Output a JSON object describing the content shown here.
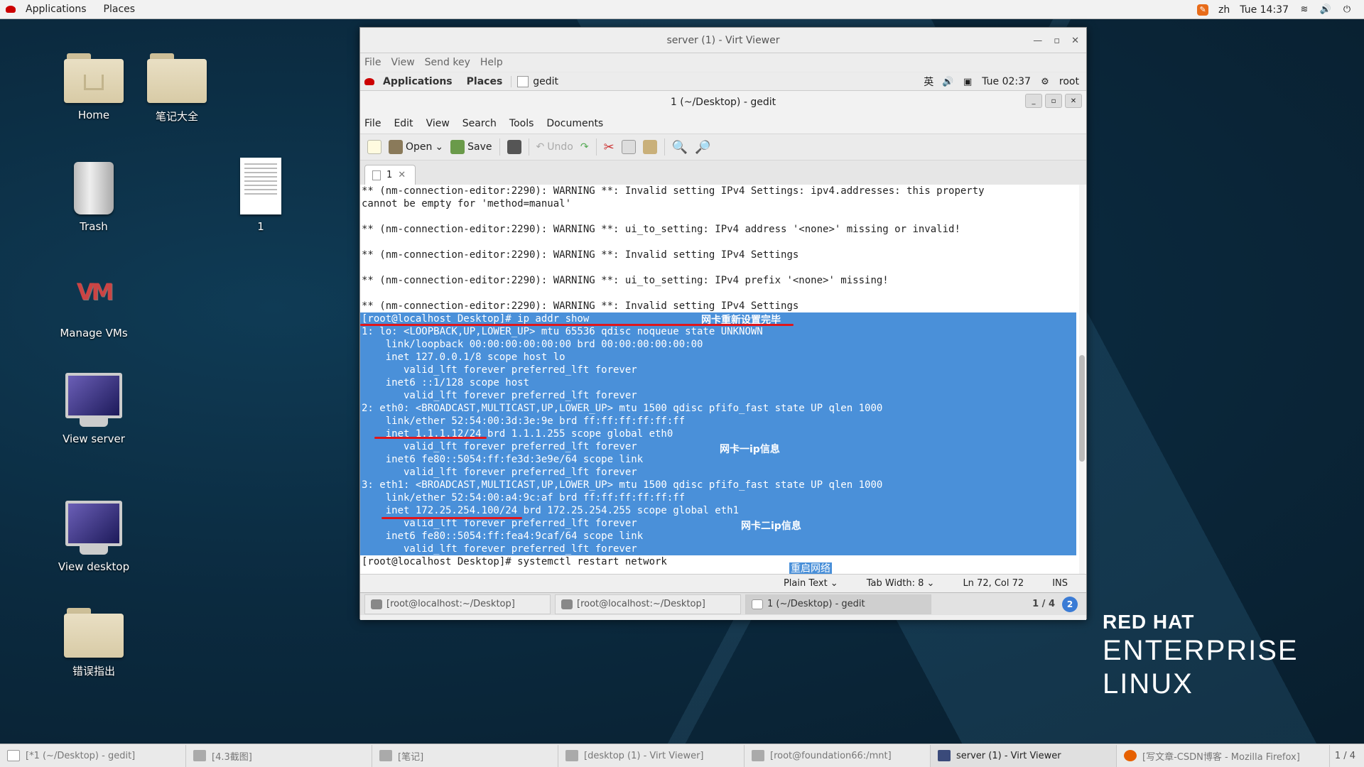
{
  "topbar": {
    "applications": "Applications",
    "places": "Places",
    "lang": "zh",
    "time": "Tue 14:37"
  },
  "desktop": {
    "icons": [
      {
        "label": "Home"
      },
      {
        "label": "笔记大全"
      },
      {
        "label": "Trash"
      },
      {
        "label": "1"
      },
      {
        "label": "Manage VMs"
      },
      {
        "label": "View server"
      },
      {
        "label": "View desktop"
      },
      {
        "label": "错误指出"
      }
    ]
  },
  "viewer": {
    "title": "server (1) - Virt Viewer",
    "menu": [
      "File",
      "View",
      "Send key",
      "Help"
    ]
  },
  "guest": {
    "topbar": {
      "applications": "Applications",
      "places": "Places",
      "app": "gedit",
      "lang": "英",
      "time": "Tue 02:37",
      "user": "root"
    },
    "window_title": "1 (~/Desktop) - gedit",
    "menu": [
      "File",
      "Edit",
      "View",
      "Search",
      "Tools",
      "Documents"
    ],
    "toolbar": {
      "open": "Open",
      "save": "Save",
      "undo": "Undo"
    },
    "tab": {
      "label": "1"
    },
    "lines": [
      {
        "t": "** (nm-connection-editor:2290): WARNING **: Invalid setting IPv4 Settings: ipv4.addresses: this property",
        "s": false
      },
      {
        "t": "cannot be empty for 'method=manual'",
        "s": false
      },
      {
        "t": "",
        "s": false
      },
      {
        "t": "** (nm-connection-editor:2290): WARNING **: ui_to_setting: IPv4 address '<none>' missing or invalid!",
        "s": false
      },
      {
        "t": "",
        "s": false
      },
      {
        "t": "** (nm-connection-editor:2290): WARNING **: Invalid setting IPv4 Settings",
        "s": false
      },
      {
        "t": "",
        "s": false
      },
      {
        "t": "** (nm-connection-editor:2290): WARNING **: ui_to_setting: IPv4 prefix '<none>' missing!",
        "s": false
      },
      {
        "t": "",
        "s": false
      },
      {
        "t": "** (nm-connection-editor:2290): WARNING **: Invalid setting IPv4 Settings",
        "s": false
      },
      {
        "t": "[root@localhost Desktop]# ip addr show",
        "s": true
      },
      {
        "t": "1: lo: <LOOPBACK,UP,LOWER_UP> mtu 65536 qdisc noqueue state UNKNOWN",
        "s": true
      },
      {
        "t": "    link/loopback 00:00:00:00:00:00 brd 00:00:00:00:00:00",
        "s": true
      },
      {
        "t": "    inet 127.0.0.1/8 scope host lo",
        "s": true
      },
      {
        "t": "       valid_lft forever preferred_lft forever",
        "s": true
      },
      {
        "t": "    inet6 ::1/128 scope host",
        "s": true
      },
      {
        "t": "       valid_lft forever preferred_lft forever",
        "s": true
      },
      {
        "t": "2: eth0: <BROADCAST,MULTICAST,UP,LOWER_UP> mtu 1500 qdisc pfifo_fast state UP qlen 1000",
        "s": true
      },
      {
        "t": "    link/ether 52:54:00:3d:3e:9e brd ff:ff:ff:ff:ff:ff",
        "s": true
      },
      {
        "t": "    inet 1.1.1.12/24 brd 1.1.1.255 scope global eth0",
        "s": true
      },
      {
        "t": "       valid_lft forever preferred_lft forever",
        "s": true
      },
      {
        "t": "    inet6 fe80::5054:ff:fe3d:3e9e/64 scope link",
        "s": true
      },
      {
        "t": "       valid_lft forever preferred_lft forever",
        "s": true
      },
      {
        "t": "3: eth1: <BROADCAST,MULTICAST,UP,LOWER_UP> mtu 1500 qdisc pfifo_fast state UP qlen 1000",
        "s": true
      },
      {
        "t": "    link/ether 52:54:00:a4:9c:af brd ff:ff:ff:ff:ff:ff",
        "s": true
      },
      {
        "t": "    inet 172.25.254.100/24 brd 172.25.254.255 scope global eth1",
        "s": true
      },
      {
        "t": "       valid_lft forever preferred_lft forever",
        "s": true
      },
      {
        "t": "    inet6 fe80::5054:ff:fea4:9caf/64 scope link",
        "s": true
      },
      {
        "t": "       valid_lft forever preferred_lft forever",
        "s": true
      },
      {
        "t": "[root@localhost Desktop]# systemctl restart network",
        "s": false
      }
    ],
    "annotations": {
      "reset_done": "网卡重新设置完毕",
      "nic1": "网卡一ip信息",
      "nic2": "网卡二ip信息",
      "restart": "重启网络"
    },
    "status": {
      "mode": "Plain Text",
      "tab_width": "Tab Width: 8",
      "pos": "Ln 72, Col 72",
      "ins": "INS"
    },
    "tasks": [
      {
        "label": "[root@localhost:~/Desktop]"
      },
      {
        "label": "[root@localhost:~/Desktop]"
      },
      {
        "label": "1 (~/Desktop) - gedit"
      }
    ],
    "pager": "1 / 4",
    "badge": "2"
  },
  "rhel": {
    "line1": "RED HAT",
    "line2": "ENTERPRISE",
    "line3": "LINUX"
  },
  "taskbar": {
    "tasks": [
      {
        "label": "[*1 (~/Desktop) - gedit]"
      },
      {
        "label": "[4.3截图]"
      },
      {
        "label": "[笔记]"
      },
      {
        "label": "[desktop (1) - Virt Viewer]"
      },
      {
        "label": "[root@foundation66:/mnt]"
      },
      {
        "label": "server (1) - Virt Viewer"
      },
      {
        "label": "[写文章-CSDN博客 - Mozilla Firefox]"
      }
    ],
    "pager": "1 / 4"
  },
  "colors": {
    "selection": "#4a90d9",
    "annotation_line": "#e0161b"
  }
}
